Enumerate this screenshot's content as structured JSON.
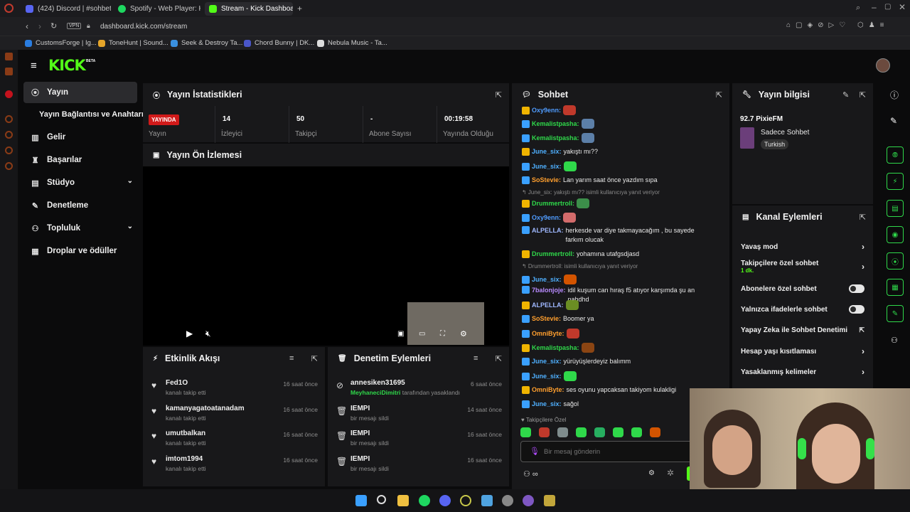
{
  "browser": {
    "tabs": [
      {
        "label": "(424) Discord | #sohbet | ",
        "color": "#5865f2"
      },
      {
        "label": "Spotify - Web Player: Her",
        "color": "#1ed760"
      },
      {
        "label": "Stream - Kick Dashboard",
        "color": "#53fc18"
      }
    ],
    "new_tab": "+",
    "vpn": "VPN",
    "url": "dashboard.kick.com/stream",
    "bookmarks": [
      "CustomsForge | Ig...",
      "ToneHunt | Sound...",
      "Seek & Destroy Ta...",
      "Chord Bunny | DK...",
      "Nebula Music - Ta..."
    ]
  },
  "brand": {
    "logo": "KICK",
    "beta": "BETA",
    "accent": "#53fc18"
  },
  "nav": {
    "items": [
      {
        "label": "Yayın",
        "icon": "broadcast-icon"
      },
      {
        "label": "Yayın Bağlantısı ve Anahtarı",
        "icon": ""
      },
      {
        "label": "Gelir",
        "icon": "chart-icon"
      },
      {
        "label": "Başarılar",
        "icon": "trophy-icon"
      },
      {
        "label": "Stüdyo",
        "icon": "studio-icon"
      },
      {
        "label": "Denetleme",
        "icon": "wrench-icon"
      },
      {
        "label": "Topluluk",
        "icon": "community-icon"
      },
      {
        "label": "Droplar ve ödüller",
        "icon": "drops-icon"
      }
    ]
  },
  "stats": {
    "title": "Yayın İstatistikleri",
    "live_badge": "YAYINDA",
    "items": [
      {
        "value": "",
        "label": "Yayın"
      },
      {
        "value": "14",
        "label": "İzleyici"
      },
      {
        "value": "50",
        "label": "Takipçi"
      },
      {
        "value": "-",
        "label": "Abone Sayısı"
      },
      {
        "value": "00:19:58",
        "label": "Yayında Olduğu"
      }
    ]
  },
  "preview": {
    "title": "Yayın Ön İzlemesi"
  },
  "activity": {
    "title": "Etkinlik Akışı",
    "events": [
      {
        "name": "Fed1O",
        "sub": "kanalı takip etti",
        "time": "16 saat önce"
      },
      {
        "name": "kamanyagatoatanadam",
        "sub": "kanalı takip etti",
        "time": "16 saat önce"
      },
      {
        "name": "umutbalkan",
        "sub": "kanalı takip etti",
        "time": "16 saat önce"
      },
      {
        "name": "imtom1994",
        "sub": "kanalı takip etti",
        "time": "16 saat önce"
      }
    ]
  },
  "moderation": {
    "title": "Denetim Eylemleri",
    "events": [
      {
        "name": "annesiken31695",
        "by": "MeyhaneciDimitri",
        "sub": "tarafından yasaklandı",
        "time": "6 saat önce"
      },
      {
        "name": "IEMPI",
        "sub": "bir mesajı sildi",
        "time": "14 saat önce"
      },
      {
        "name": "IEMPI",
        "sub": "bir mesajı sildi",
        "time": "16 saat önce"
      },
      {
        "name": "IEMPI",
        "sub": "bir mesajı sildi",
        "time": "16 saat önce"
      }
    ]
  },
  "chat": {
    "title": "Sohbet",
    "messages": [
      {
        "user": "Oxy9enn",
        "color": "#4f9cff",
        "text": ""
      },
      {
        "user": "Kemalistpasha",
        "color": "#2fd84a",
        "text": ""
      },
      {
        "user": "Kemalistpasha",
        "color": "#2fd84a",
        "text": ""
      },
      {
        "user": "June_six",
        "color": "#4fb0ff",
        "text": "yakıştı mı??"
      },
      {
        "user": "June_six",
        "color": "#4fb0ff",
        "text": ""
      },
      {
        "user": "SoStevie",
        "color": "#ff9f2e",
        "text": "Lan yarım saat önce yazdım sıpa"
      },
      {
        "user": "Drummertroll",
        "color": "#2fd84a",
        "text": "",
        "reply": "June_six: yakıştı mı?? isimli kullanıcıya yanıt veriyor"
      },
      {
        "user": "Oxy9enn",
        "color": "#4f9cff",
        "text": ""
      },
      {
        "user": "ALPELLA",
        "color": "#9fb8ff",
        "text": "herkesde var diye takmayacağım , bu sayede farkım olucak"
      },
      {
        "user": "Drummertroll",
        "color": "#2fd84a",
        "text": "yohamına utafgsdjasd"
      },
      {
        "user": "June_six",
        "color": "#4fb0ff",
        "text": "",
        "reply": "Drummertroll: isimli kullanıcıya yanıt veriyor"
      },
      {
        "user": "7balonjoje",
        "color": "#b88bff",
        "text": "idil kuşum can hıraş f5 atıyor karşımda şu an nahdhd"
      },
      {
        "user": "ALPELLA",
        "color": "#9fb8ff",
        "text": ""
      },
      {
        "user": "SoStevie",
        "color": "#ff9f2e",
        "text": "Boomer ya"
      },
      {
        "user": "OmniByte",
        "color": "#ff9f2e",
        "text": ""
      },
      {
        "user": "Kemalistpasha",
        "color": "#2fd84a",
        "text": ""
      },
      {
        "user": "June_six",
        "color": "#4fb0ff",
        "text": "yürüyüşlerdeyiz balımm"
      },
      {
        "user": "June_six",
        "color": "#4fb0ff",
        "text": ""
      },
      {
        "user": "OmniByte",
        "color": "#ff9f2e",
        "text": "ses oyunu yapcaksan takiyom kulakligi"
      },
      {
        "user": "June_six",
        "color": "#4fb0ff",
        "text": "sağol"
      }
    ],
    "followers_only": "Takipçilere Özel",
    "input_placeholder": "Bir mesaj gönderin"
  },
  "info": {
    "title": "Yayın bilgisi",
    "stream_title": "92.7 PixieFM",
    "category": "Sadece Sohbet",
    "tag": "Turkish"
  },
  "channel_actions": {
    "title": "Kanal Eylemleri",
    "items": [
      {
        "label": "Yavaş mod",
        "control": "chevron"
      },
      {
        "label": "Takipçilere özel sohbet",
        "sub": "1 dk.",
        "control": "chevron"
      },
      {
        "label": "Abonelere özel sohbet",
        "control": "toggle"
      },
      {
        "label": "Yalnızca ifadelerle sohbet",
        "control": "toggle"
      },
      {
        "label": "Yapay Zeka ile Sohbet Denetimi",
        "control": "external"
      },
      {
        "label": "Hesap yaşı kısıtlaması",
        "control": "chevron"
      },
      {
        "label": "Yasaklanmış kelimeler",
        "control": "chevron"
      }
    ]
  }
}
